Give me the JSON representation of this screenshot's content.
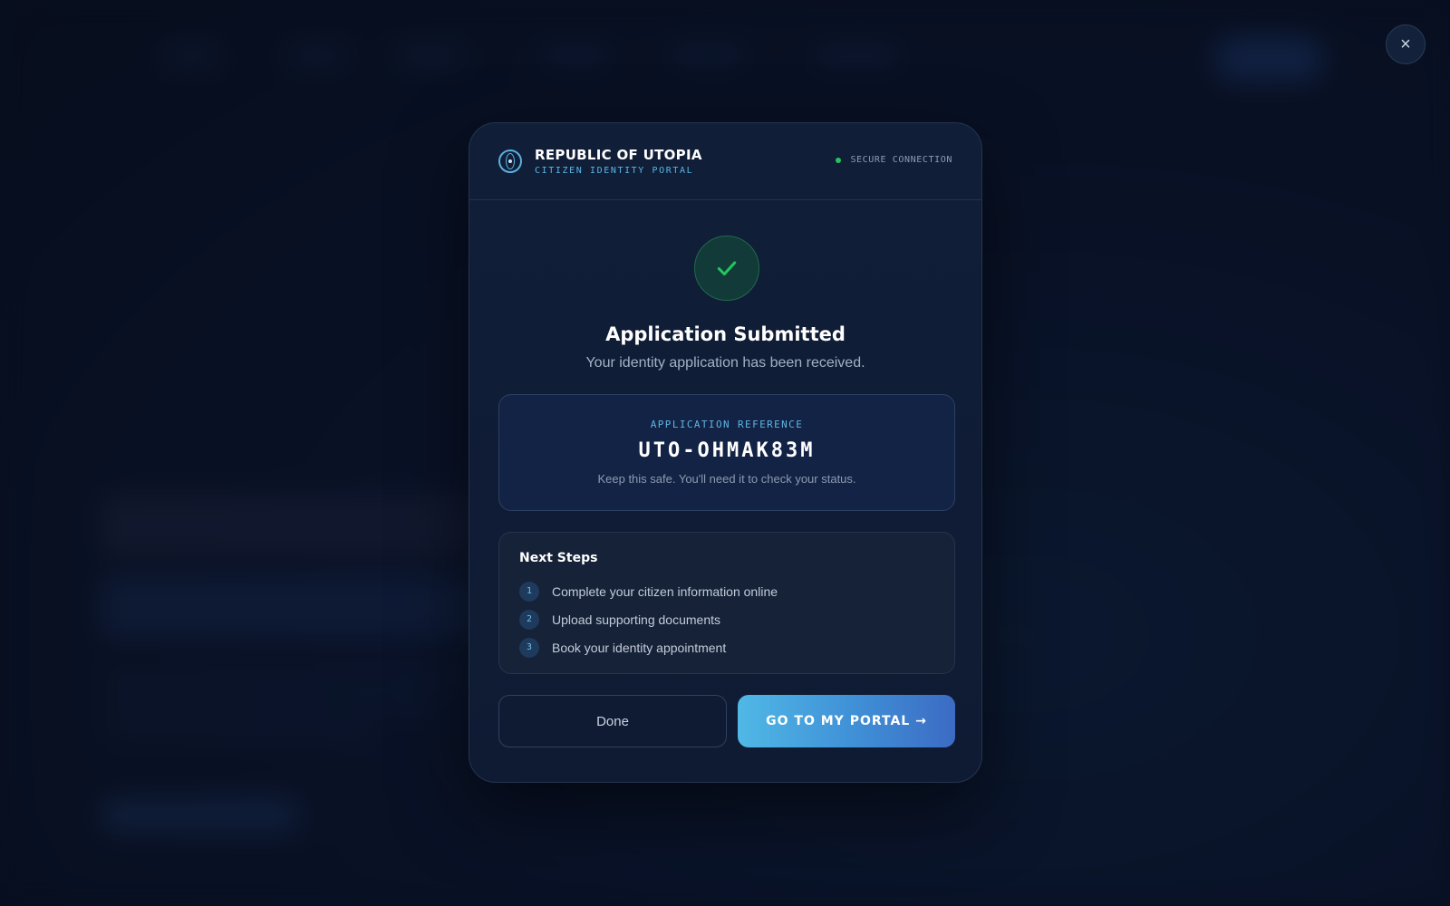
{
  "header": {
    "brand_title": "REPUBLIC OF UTOPIA",
    "brand_subtitle": "CITIZEN IDENTITY PORTAL",
    "secure_label": "SECURE CONNECTION"
  },
  "close_icon": "×",
  "dialog": {
    "title": "Application Submitted",
    "subtitle": "Your identity application has been received."
  },
  "reference": {
    "label": "APPLICATION REFERENCE",
    "code": "UTO-OHMAK83M",
    "note": "Keep this safe. You'll need it to check your status."
  },
  "next_steps": {
    "title": "Next Steps",
    "items": [
      {
        "number": "1",
        "text": "Complete your citizen information online"
      },
      {
        "number": "2",
        "text": "Upload supporting documents"
      },
      {
        "number": "3",
        "text": "Book your identity appointment"
      }
    ]
  },
  "actions": {
    "done_label": "Done",
    "portal_label": "GO TO MY PORTAL →"
  },
  "colors": {
    "accent": "#50b8e6",
    "success": "#22c55e",
    "background": "#0a1324"
  },
  "icons": {
    "emblem": "emblem-icon",
    "check": "check-icon",
    "close": "close-icon"
  }
}
